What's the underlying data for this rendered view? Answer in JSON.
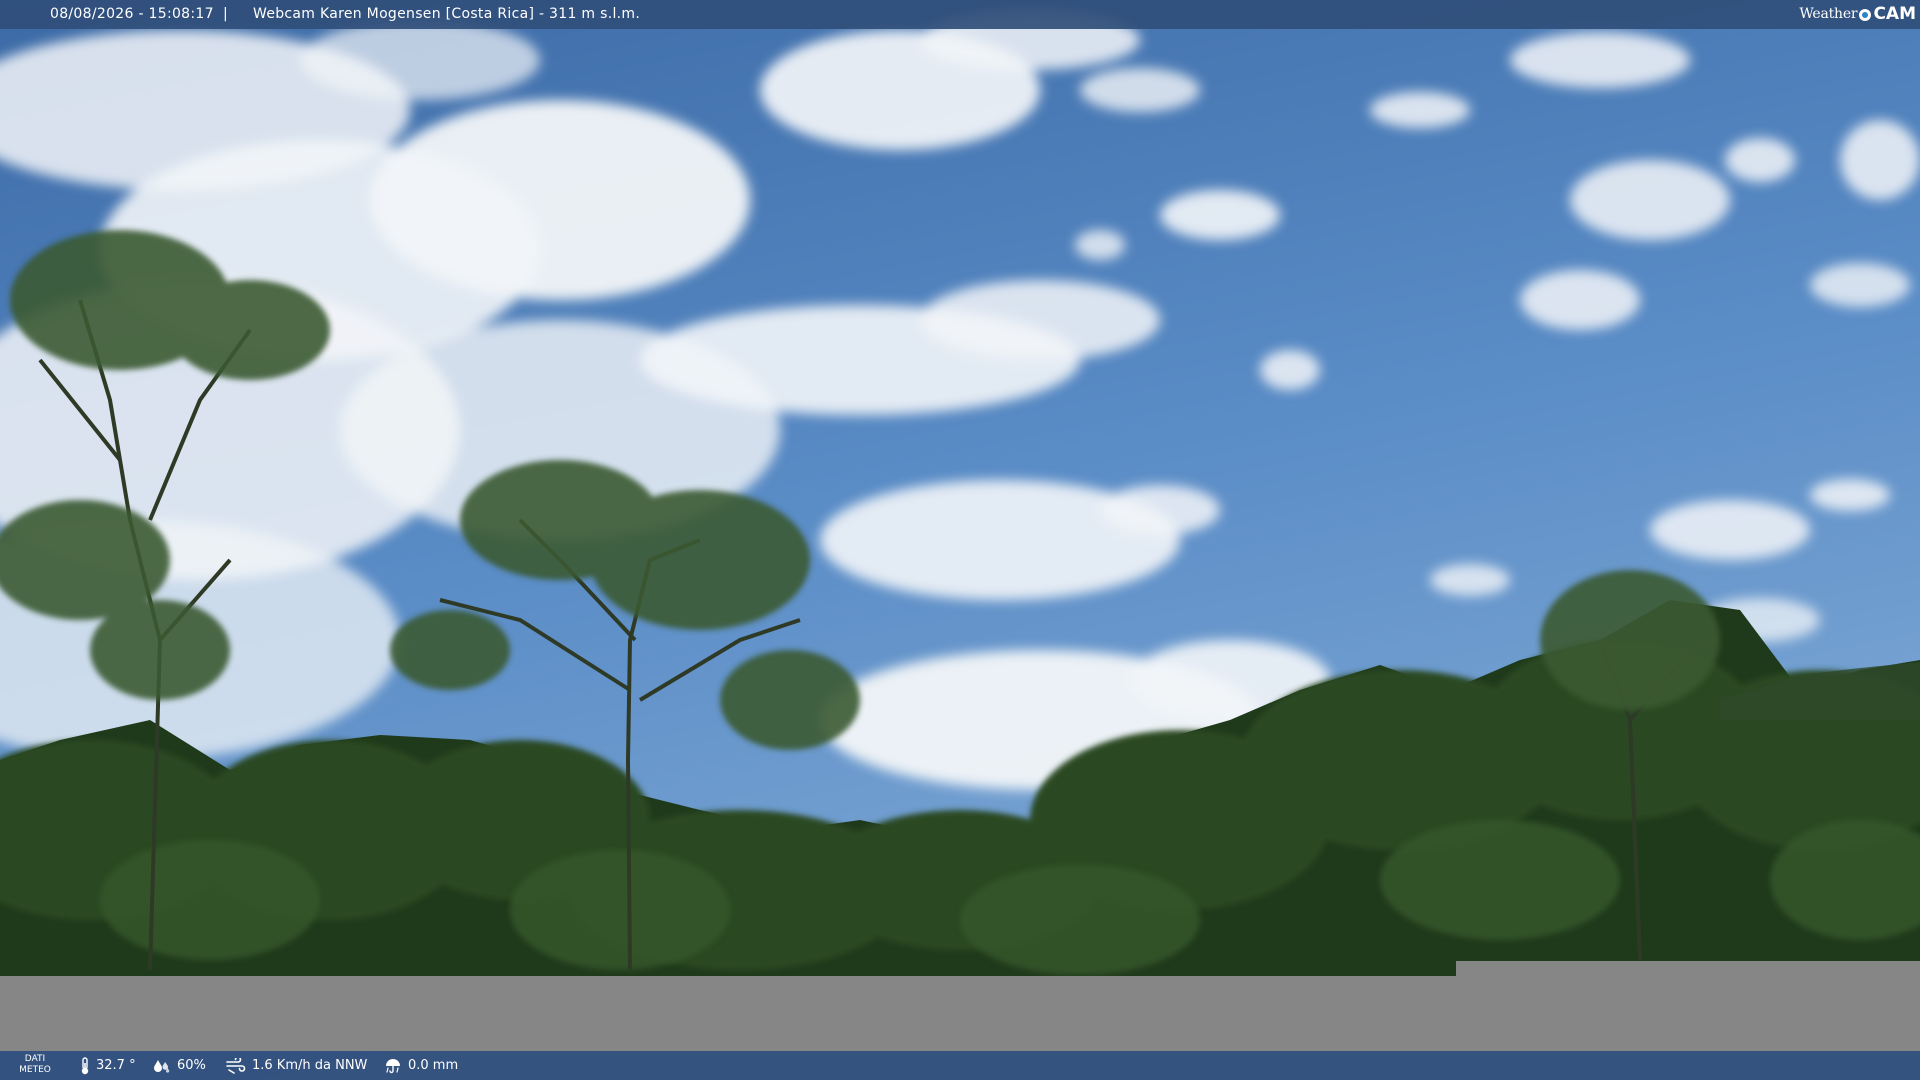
{
  "header": {
    "datetime": "08/08/2026 - 15:08:17",
    "separator": "|",
    "title": "Webcam Karen Mogensen [Costa Rica]  - 311 m s.l.m.",
    "brand_weather": "Weather",
    "brand_cam": "CAM"
  },
  "footer": {
    "meteo_label_1": "DATI",
    "meteo_label_2": "METEO",
    "temperature": "32.7 °",
    "humidity": "60%",
    "wind": "1.6 Km/h da NNW",
    "rain": "0.0 mm"
  },
  "icons": {
    "temperature": "thermometer-icon",
    "humidity": "droplets-icon",
    "wind": "wind-icon",
    "rain": "rain-icon"
  },
  "colors": {
    "sky_top": "#3f6ea8",
    "sky_bottom": "#6d9cd0",
    "foliage": "#23401e",
    "bar": "#304e7a",
    "gray_band": "#868686"
  }
}
